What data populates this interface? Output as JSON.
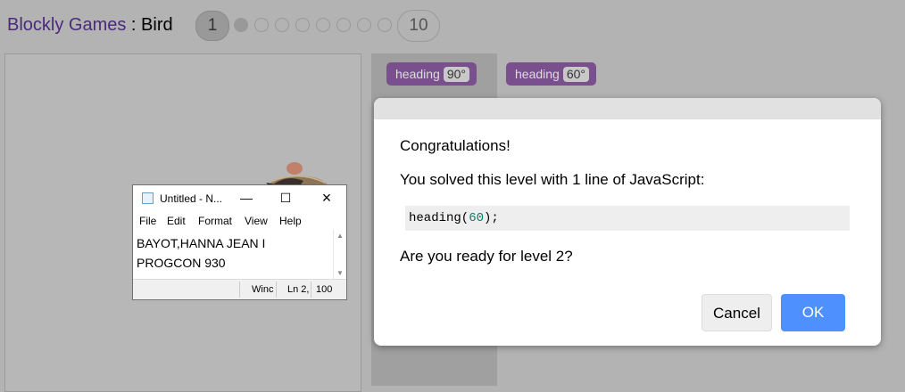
{
  "header": {
    "brand": "Blockly Games",
    "separator": " : ",
    "game": "Bird",
    "current_level": "1",
    "last_level": "10",
    "progress_dots": 8
  },
  "toolbox": {
    "block": {
      "label": "heading",
      "value": "90°"
    }
  },
  "workspace": {
    "block": {
      "label": "heading",
      "value": "60°"
    }
  },
  "notepad": {
    "title": "Untitled - N...",
    "menu": [
      "File",
      "Edit",
      "Format",
      "View",
      "Help"
    ],
    "content": "BAYOT,HANNA JEAN I\nPROGCON 930",
    "status": {
      "encoding": "Winc",
      "position": "Ln 2,",
      "zoom": "100"
    }
  },
  "dialog": {
    "title": "Congratulations!",
    "message": "You solved this level with 1 line of JavaScript:",
    "code_fn": "heading(",
    "code_num": "60",
    "code_end": ");",
    "question": "Are you ready for level 2?",
    "cancel_label": "Cancel",
    "ok_label": "OK"
  },
  "colors": {
    "brand": "#4a2a7a",
    "block": "#7a4f8e",
    "ok_button": "#4d90fe"
  }
}
